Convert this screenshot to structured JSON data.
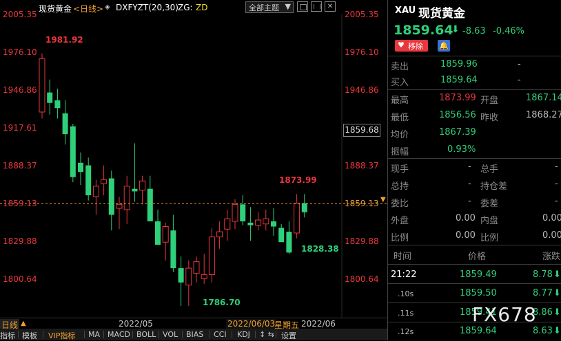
{
  "header": {
    "instrument": "现货黄金",
    "period_label": "<日线>",
    "indicator": "DXFYZT(20,30)",
    "zg_label": "ZG:",
    "zd_label": "ZD",
    "theme_select": "全部主题"
  },
  "y_axis_labels": [
    "2005.35",
    "1976.10",
    "1946.86",
    "1917.61",
    "1888.37",
    "1859.13",
    "1829.88",
    "1800.64"
  ],
  "price_tag": "1859.68",
  "current_line_label": "1859.13",
  "annotations": {
    "high1": "1981.92",
    "high2": "1873.99",
    "low1": "1786.70",
    "low2": "1828.38"
  },
  "x_axis": {
    "period": "日线",
    "month1": "2022/05",
    "cursor_date": "2022/06/03",
    "cursor_weekday": "星期五",
    "month2": "2022/06"
  },
  "tabs": [
    "指标",
    "模板",
    "VIP指标",
    "MA",
    "MACD",
    "BOLL",
    "VOL",
    "BIAS",
    "CCI",
    "KDJ",
    "设置"
  ],
  "chart_data": {
    "type": "candlestick",
    "ylim": [
      1779,
      2012
    ],
    "candles": [
      {
        "o": 1937,
        "h": 1982,
        "l": 1932,
        "c": 1978
      },
      {
        "o": 1952,
        "h": 1962,
        "l": 1935,
        "c": 1944
      },
      {
        "o": 1946,
        "h": 1955,
        "l": 1932,
        "c": 1940
      },
      {
        "o": 1936,
        "h": 1946,
        "l": 1912,
        "c": 1920
      },
      {
        "o": 1926,
        "h": 1928,
        "l": 1883,
        "c": 1887
      },
      {
        "o": 1898,
        "h": 1906,
        "l": 1881,
        "c": 1891
      },
      {
        "o": 1896,
        "h": 1902,
        "l": 1869,
        "c": 1873
      },
      {
        "o": 1872,
        "h": 1885,
        "l": 1858,
        "c": 1880
      },
      {
        "o": 1882,
        "h": 1896,
        "l": 1873,
        "c": 1885
      },
      {
        "o": 1886,
        "h": 1892,
        "l": 1846,
        "c": 1858
      },
      {
        "o": 1863,
        "h": 1872,
        "l": 1847,
        "c": 1866
      },
      {
        "o": 1862,
        "h": 1888,
        "l": 1851,
        "c": 1880
      },
      {
        "o": 1878,
        "h": 1913,
        "l": 1868,
        "c": 1876
      },
      {
        "o": 1877,
        "h": 1888,
        "l": 1866,
        "c": 1884
      },
      {
        "o": 1878,
        "h": 1888,
        "l": 1862,
        "c": 1853
      },
      {
        "o": 1853,
        "h": 1862,
        "l": 1835,
        "c": 1835
      },
      {
        "o": 1837,
        "h": 1852,
        "l": 1823,
        "c": 1849
      },
      {
        "o": 1846,
        "h": 1858,
        "l": 1814,
        "c": 1817
      },
      {
        "o": 1817,
        "h": 1826,
        "l": 1788,
        "c": 1806
      },
      {
        "o": 1804,
        "h": 1823,
        "l": 1788,
        "c": 1817
      },
      {
        "o": 1813,
        "h": 1826,
        "l": 1806,
        "c": 1822
      },
      {
        "o": 1809,
        "h": 1828,
        "l": 1805,
        "c": 1812
      },
      {
        "o": 1812,
        "h": 1848,
        "l": 1806,
        "c": 1841
      },
      {
        "o": 1841,
        "h": 1853,
        "l": 1832,
        "c": 1845
      },
      {
        "o": 1847,
        "h": 1862,
        "l": 1838,
        "c": 1855
      },
      {
        "o": 1853,
        "h": 1870,
        "l": 1847,
        "c": 1866
      },
      {
        "o": 1866,
        "h": 1873,
        "l": 1850,
        "c": 1853
      },
      {
        "o": 1852,
        "h": 1864,
        "l": 1838,
        "c": 1850
      },
      {
        "o": 1850,
        "h": 1860,
        "l": 1846,
        "c": 1854
      },
      {
        "o": 1851,
        "h": 1862,
        "l": 1846,
        "c": 1855
      },
      {
        "o": 1853,
        "h": 1863,
        "l": 1842,
        "c": 1849
      },
      {
        "o": 1848,
        "h": 1851,
        "l": 1838,
        "c": 1837
      },
      {
        "o": 1845,
        "h": 1853,
        "l": 1828,
        "c": 1829
      },
      {
        "o": 1844,
        "h": 1874,
        "l": 1840,
        "c": 1867
      },
      {
        "o": 1867,
        "h": 1874,
        "l": 1856,
        "c": 1860
      }
    ]
  },
  "panel": {
    "code": "XAU",
    "name": "现货黄金",
    "price": "1859.64",
    "arrow": "⬇",
    "change": "-8.63",
    "change_pct": "-0.46%",
    "remove_btn": "移除",
    "sell_label": "卖出",
    "sell_value": "1859.96",
    "sell_vol": "-",
    "buy_label": "买入",
    "buy_value": "1859.64",
    "buy_vol": "-",
    "high_label": "最高",
    "high_value": "1873.99",
    "open_label": "开盘",
    "open_value": "1867.14",
    "low_label": "最低",
    "low_value": "1856.56",
    "prev_label": "昨收",
    "prev_value": "1868.27",
    "avg_label": "均价",
    "avg_value": "1867.39",
    "amp_label": "振幅",
    "amp_value": "0.93%",
    "cur_vol_label": "现手",
    "cur_vol_value": "-",
    "total_vol_label": "总手",
    "total_vol_value": "-",
    "oi_label": "总持",
    "oi_value": "-",
    "oi_chg_label": "持仓差",
    "oi_chg_value": "-",
    "bid_ratio_label": "委比",
    "bid_ratio_value": "-",
    "bid_diff_label": "委差",
    "bid_diff_value": "-",
    "outer_label": "外盘",
    "outer_value": "0.00",
    "inner_label": "内盘",
    "inner_value": "0.00",
    "ratio1_label": "比例",
    "ratio1_value": "0.00",
    "ratio2_label": "比例",
    "ratio2_value": "0.00",
    "ticks_header": {
      "time": "时间",
      "price": "价格",
      "change": "涨跌"
    },
    "ticks": [
      {
        "time": "21:22",
        "price": "1859.49",
        "change": "8.78"
      },
      {
        "time": ".10s",
        "price": "1859.50",
        "change": "8.77"
      },
      {
        "time": ".11s",
        "price": "1859.41",
        "change": "8.86"
      },
      {
        "time": ".12s",
        "price": "1859.64",
        "change": "8.63"
      }
    ],
    "watermark": "FX678"
  }
}
